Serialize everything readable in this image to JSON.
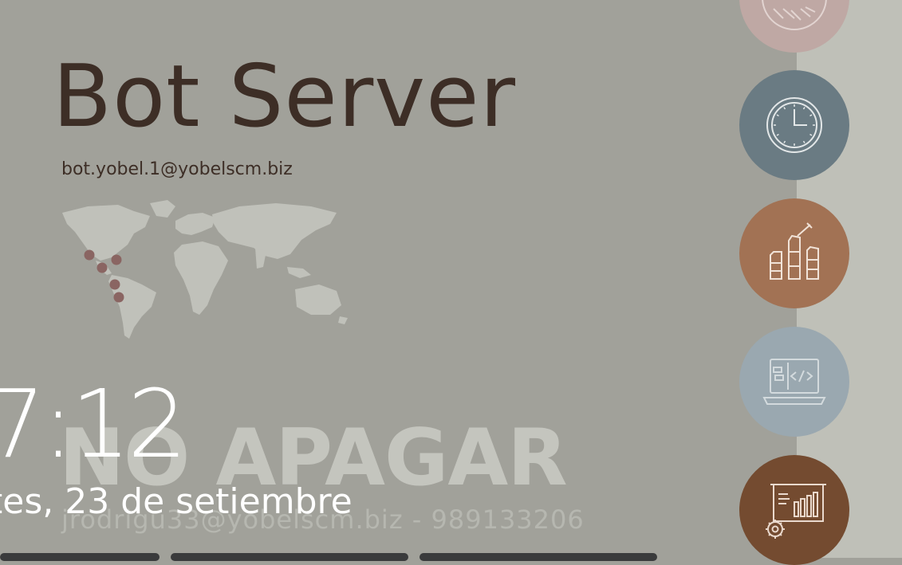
{
  "banner": {
    "title": "Bot Server",
    "email": "bot.yobel.1@yobelscm.biz",
    "warning": "NO APAGAR",
    "contact": "jrodrigu33@yobelscm.biz  -  989133206"
  },
  "lockscreen": {
    "time": "7:12",
    "date": "tes, 23 de setiembre"
  },
  "icons": [
    "handshake-icon",
    "clock-icon",
    "raised-fists-icon",
    "laptop-code-icon",
    "presentation-chart-icon"
  ],
  "colors": {
    "background": "#a1a19a",
    "title": "#3d2e26",
    "circle_pink": "#bfa8a4",
    "circle_slate": "#6a7b83",
    "circle_copper": "#a27254",
    "circle_blue_grey": "#9aa8b0",
    "circle_brown": "#744b30"
  }
}
